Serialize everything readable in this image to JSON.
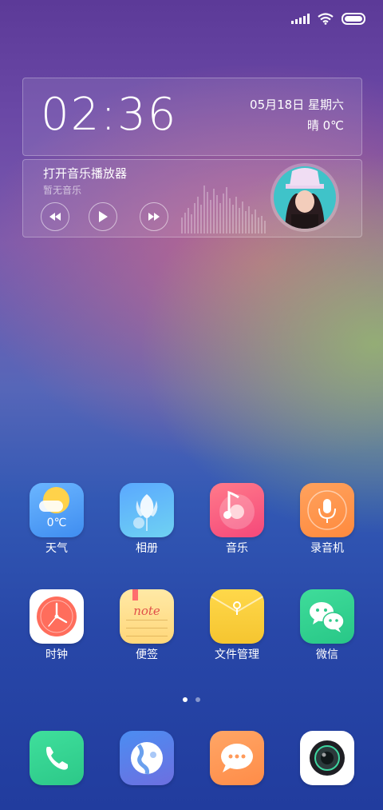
{
  "clock": {
    "time": "02:36",
    "date": "05月18日  星期六",
    "weather": "晴  0℃"
  },
  "music": {
    "title": "打开音乐播放器",
    "subtitle": "暂无音乐"
  },
  "apps": [
    {
      "label": "天气",
      "icon": "weather-icon",
      "temp": "0℃"
    },
    {
      "label": "相册",
      "icon": "gallery-icon"
    },
    {
      "label": "音乐",
      "icon": "music-icon"
    },
    {
      "label": "录音机",
      "icon": "recorder-icon"
    },
    {
      "label": "时钟",
      "icon": "clock-icon"
    },
    {
      "label": "便签",
      "icon": "notes-icon",
      "note_text": "note"
    },
    {
      "label": "文件管理",
      "icon": "file-manager-icon"
    },
    {
      "label": "微信",
      "icon": "wechat-icon"
    }
  ],
  "dock": [
    {
      "icon": "phone-icon"
    },
    {
      "icon": "browser-icon"
    },
    {
      "icon": "messages-icon"
    },
    {
      "icon": "camera-icon"
    }
  ],
  "page_indicator": {
    "count": 2,
    "current": 1
  }
}
